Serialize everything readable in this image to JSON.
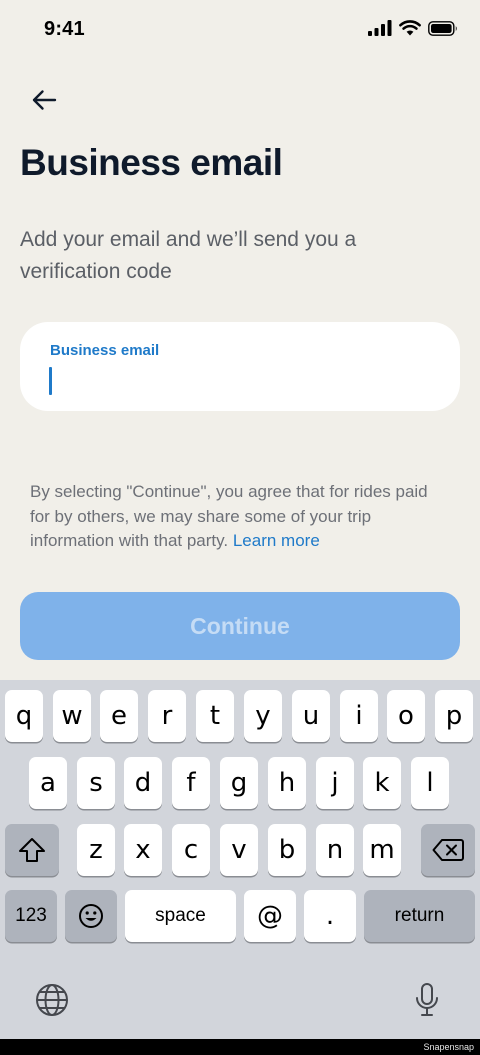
{
  "status_bar": {
    "time": "9:41"
  },
  "page": {
    "title": "Business email",
    "subtitle": "Add your email and we’ll send you a verification code"
  },
  "email_field": {
    "label": "Business email",
    "value": ""
  },
  "disclaimer": {
    "text": "By selecting \"Continue\", you agree that for rides paid for by others, we may share some of your trip information with that party. ",
    "link": "Learn more"
  },
  "continue_button": {
    "label": "Continue",
    "enabled": false
  },
  "keyboard": {
    "row1": [
      "q",
      "w",
      "e",
      "r",
      "t",
      "y",
      "u",
      "i",
      "o",
      "p"
    ],
    "row2": [
      "a",
      "s",
      "d",
      "f",
      "g",
      "h",
      "j",
      "k",
      "l"
    ],
    "row3": [
      "z",
      "x",
      "c",
      "v",
      "b",
      "n",
      "m"
    ],
    "numbers_label": "123",
    "space_label": "space",
    "at_label": "@",
    "dot_label": ".",
    "return_label": "return"
  },
  "watermark": "Snapensnap",
  "colors": {
    "background": "#f1efe9",
    "accent": "#1f7ac9",
    "button_disabled": "#7fb2ea",
    "keyboard_bg": "#d2d5db"
  },
  "icons": [
    "signal-icon",
    "wifi-icon",
    "battery-icon",
    "back-arrow-icon",
    "shift-icon",
    "backspace-icon",
    "emoji-icon",
    "globe-icon",
    "microphone-icon"
  ]
}
